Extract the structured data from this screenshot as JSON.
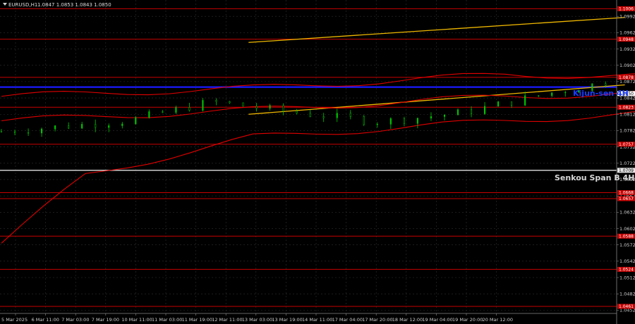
{
  "header": {
    "symbol": "EURUSD,H1",
    "ohlc": "1.0847 1.0853 1.0843 1.0850"
  },
  "colors": {
    "background": "#000000",
    "grid": "#2e2e2e",
    "bull_candle": "#00c800",
    "bear_candle": "#00c800",
    "bollinger": "#e00000",
    "channel": "#f0b800",
    "level_red": "#c80000",
    "kijun": "#1a1aff",
    "senkou": "#e0e0e0",
    "price_label_bg": "#c80000"
  },
  "chart_data": {
    "type": "line",
    "title": "EURUSD,H1",
    "xlabel": "",
    "ylabel": "",
    "ylim": [
      1.0446,
      1.1022
    ],
    "grid": true,
    "y_ticks": [
      1.0992,
      1.0962,
      1.0932,
      1.0902,
      1.0872,
      1.0842,
      1.0812,
      1.0782,
      1.0752,
      1.0722,
      1.0692,
      1.0662,
      1.0632,
      1.0602,
      1.0572,
      1.0542,
      1.0512,
      1.0482,
      1.0452
    ],
    "x_ticks": [
      "5 Mar 2025",
      "6 Mar 11:00",
      "7 Mar 03:00",
      "7 Mar 19:00",
      "10 Mar 11:00",
      "11 Mar 03:00",
      "11 Mar 19:00",
      "12 Mar 11:00",
      "13 Mar 03:00",
      "13 Mar 19:00",
      "14 Mar 11:00",
      "17 Mar 04:00",
      "17 Mar 20:00",
      "18 Mar 12:00",
      "19 Mar 04:00",
      "19 Mar 20:00",
      "20 Mar 12:00"
    ],
    "price_path": [
      [
        0,
        1.078
      ],
      [
        3,
        1.08
      ],
      [
        5,
        1.0835
      ],
      [
        7,
        1.0815
      ],
      [
        9,
        1.0798
      ],
      [
        11,
        1.0815
      ],
      [
        13,
        1.085
      ],
      [
        15,
        1.088
      ],
      [
        17,
        1.086
      ],
      [
        19,
        1.0842
      ],
      [
        21,
        1.0838
      ],
      [
        23,
        1.0822
      ],
      [
        25,
        1.083
      ],
      [
        27,
        1.0838
      ],
      [
        29,
        1.0842
      ],
      [
        30,
        1.086
      ],
      [
        31,
        1.09
      ],
      [
        32,
        1.0932
      ],
      [
        33,
        1.0925
      ],
      [
        35,
        1.0902
      ],
      [
        37,
        1.0895
      ],
      [
        39,
        1.0915
      ],
      [
        41,
        1.089
      ],
      [
        43,
        1.088
      ],
      [
        45,
        1.087
      ],
      [
        47,
        1.0862
      ],
      [
        49,
        1.0842
      ],
      [
        51,
        1.0845
      ],
      [
        53,
        1.084
      ],
      [
        55,
        1.0855
      ],
      [
        56,
        1.0885
      ],
      [
        58,
        1.089
      ],
      [
        60,
        1.0885
      ],
      [
        62,
        1.09
      ],
      [
        64,
        1.0915
      ],
      [
        66,
        1.0928
      ],
      [
        68,
        1.0925
      ],
      [
        70,
        1.0935
      ],
      [
        72,
        1.094
      ],
      [
        74,
        1.0945
      ],
      [
        76,
        1.0935
      ],
      [
        78,
        1.0932
      ],
      [
        80,
        1.091
      ],
      [
        82,
        1.09
      ],
      [
        84,
        1.0885
      ],
      [
        86,
        1.0878
      ],
      [
        88,
        1.09
      ],
      [
        90,
        1.0895
      ],
      [
        92,
        1.087
      ],
      [
        93,
        1.0845
      ],
      [
        94,
        1.0818
      ],
      [
        95,
        1.083
      ],
      [
        96,
        1.085
      ]
    ],
    "bollinger_upper": [
      [
        0,
        1.0845
      ],
      [
        6,
        1.086
      ],
      [
        12,
        1.0885
      ],
      [
        18,
        1.088
      ],
      [
        24,
        1.0862
      ],
      [
        30,
        1.0925
      ],
      [
        34,
        1.0958
      ],
      [
        40,
        1.0935
      ],
      [
        46,
        1.0905
      ],
      [
        52,
        1.088
      ],
      [
        56,
        1.09
      ],
      [
        62,
        1.0925
      ],
      [
        68,
        1.095
      ],
      [
        74,
        1.0962
      ],
      [
        80,
        1.0948
      ],
      [
        86,
        1.0925
      ],
      [
        92,
        1.0925
      ],
      [
        96,
        1.094
      ]
    ],
    "bollinger_middle": [
      [
        0,
        1.08
      ],
      [
        6,
        1.082
      ],
      [
        12,
        1.0845
      ],
      [
        18,
        1.0855
      ],
      [
        24,
        1.0842
      ],
      [
        30,
        1.087
      ],
      [
        34,
        1.0905
      ],
      [
        40,
        1.09
      ],
      [
        46,
        1.088
      ],
      [
        52,
        1.0858
      ],
      [
        56,
        1.0865
      ],
      [
        62,
        1.0895
      ],
      [
        68,
        1.0925
      ],
      [
        74,
        1.0938
      ],
      [
        80,
        1.0915
      ],
      [
        86,
        1.0895
      ],
      [
        92,
        1.089
      ],
      [
        96,
        1.0875
      ]
    ],
    "bollinger_lower": [
      [
        0,
        1.0575
      ],
      [
        2,
        1.07
      ],
      [
        6,
        1.077
      ],
      [
        12,
        1.08
      ],
      [
        18,
        1.0825
      ],
      [
        24,
        1.0815
      ],
      [
        30,
        1.083
      ],
      [
        34,
        1.085
      ],
      [
        40,
        1.0862
      ],
      [
        46,
        1.085
      ],
      [
        52,
        1.0832
      ],
      [
        56,
        1.083
      ],
      [
        62,
        1.0862
      ],
      [
        68,
        1.089
      ],
      [
        74,
        1.0905
      ],
      [
        80,
        1.088
      ],
      [
        86,
        1.086
      ],
      [
        92,
        1.084
      ],
      [
        96,
        1.082
      ]
    ],
    "channel_upper": [
      [
        25,
        1.0944
      ],
      [
        59,
        1.099
      ]
    ],
    "channel_lower": [
      [
        25,
        1.0812
      ],
      [
        59,
        1.0866
      ]
    ],
    "horizontal_levels": [
      {
        "price": 1.1006,
        "label": "1.1006",
        "kind": "red"
      },
      {
        "price": 1.095,
        "label": "1.0948",
        "kind": "red"
      },
      {
        "price": 1.088,
        "label": "1.0878",
        "kind": "red"
      },
      {
        "price": 1.0825,
        "label": "1.0823",
        "kind": "red"
      },
      {
        "price": 1.0757,
        "label": "1.0757",
        "kind": "red"
      },
      {
        "price": 1.0668,
        "label": "1.0668",
        "kind": "red"
      },
      {
        "price": 1.0657,
        "label": "1.0657",
        "kind": "red"
      },
      {
        "price": 1.0588,
        "label": "1.0588",
        "kind": "red"
      },
      {
        "price": 1.0527,
        "label": "1.0524",
        "kind": "red"
      },
      {
        "price": 1.0459,
        "label": "1.0461",
        "kind": "red"
      }
    ],
    "kijun": {
      "price": 1.0862,
      "label": "Kijun-sen 4H"
    },
    "senkou": {
      "price": 1.0709,
      "label": "Senkou Span B 4H",
      "tag": "1.0709"
    },
    "current_price": {
      "price": 1.085,
      "label": "1.0850"
    }
  }
}
